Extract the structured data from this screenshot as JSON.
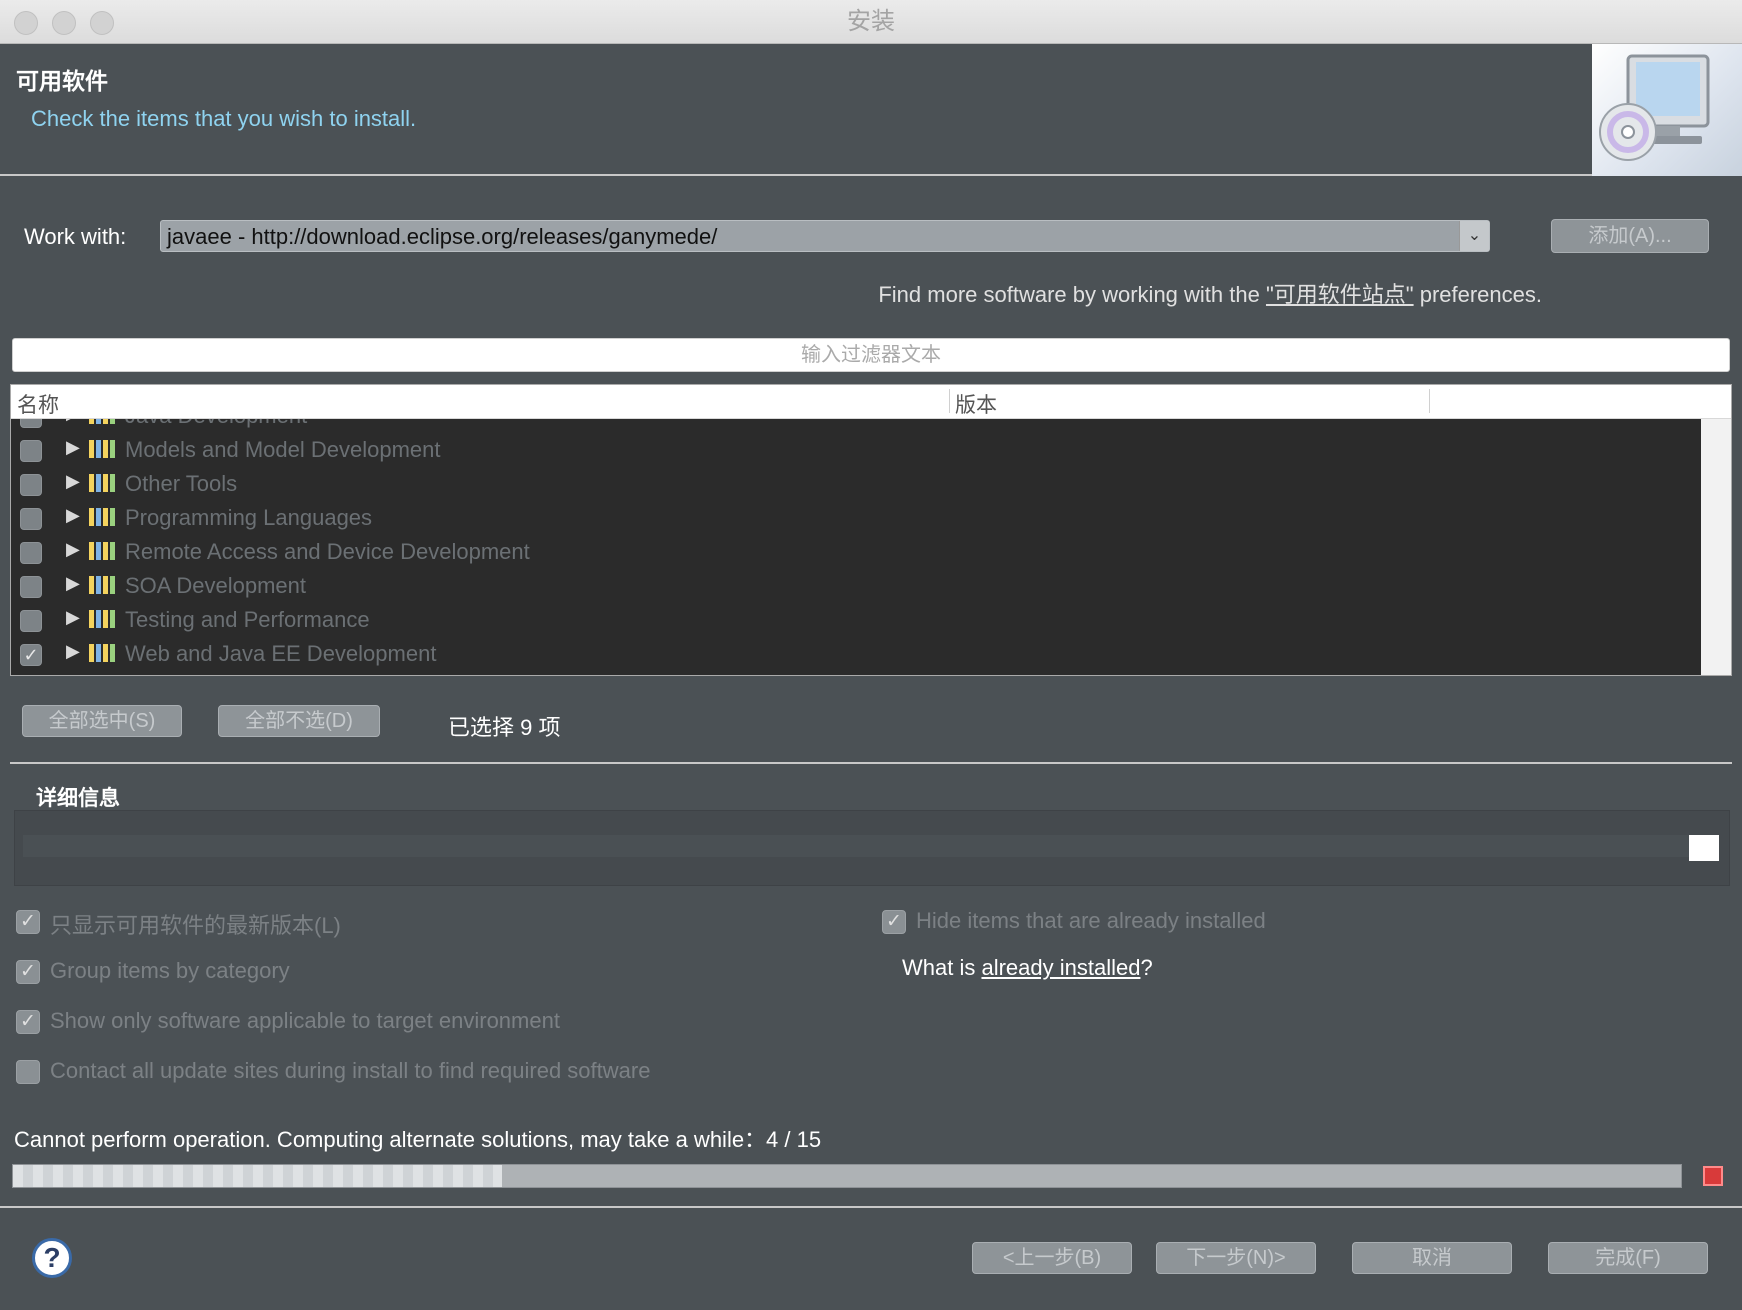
{
  "window": {
    "title": "安装"
  },
  "banner": {
    "title": "可用软件",
    "message": "Check the items that you wish to install."
  },
  "work_with": {
    "label": "Work with:",
    "value": "javaee - http://download.eclipse.org/releases/ganymede/",
    "add_button": "添加(A)..."
  },
  "find_more": {
    "prefix": "Find more software by working with the ",
    "link": "\"可用软件站点\"",
    "suffix": " preferences."
  },
  "filter": {
    "placeholder": "输入过滤器文本"
  },
  "tree": {
    "col_name": "名称",
    "col_version": "版本",
    "rows": [
      {
        "label": "Java Development",
        "checked": false
      },
      {
        "label": "Models and Model Development",
        "checked": false
      },
      {
        "label": "Other Tools",
        "checked": false
      },
      {
        "label": "Programming Languages",
        "checked": false
      },
      {
        "label": "Remote Access and Device Development",
        "checked": false
      },
      {
        "label": "SOA Development",
        "checked": false
      },
      {
        "label": "Testing and Performance",
        "checked": false
      },
      {
        "label": "Web and Java EE Development",
        "checked": true
      }
    ]
  },
  "selection": {
    "select_all": "全部选中(S)",
    "deselect_all": "全部不选(D)",
    "count_text": "已选择 9 项"
  },
  "details": {
    "title": "详细信息"
  },
  "options": {
    "latest_only": {
      "label": "只显示可用软件的最新版本(L)",
      "checked": true
    },
    "group_by_category": {
      "label": "Group items by category",
      "checked": true
    },
    "target_env": {
      "label": "Show only software applicable to target environment",
      "checked": true
    },
    "contact_sites": {
      "label": "Contact all update sites during install to find required software",
      "checked": false
    },
    "hide_installed": {
      "label": "Hide items that are already installed",
      "checked": true
    },
    "what_is_prefix": "What is ",
    "what_is_link": "already installed",
    "what_is_suffix": "?"
  },
  "status": {
    "message": "Cannot perform operation. Computing alternate solutions, may take a while：4 / 15",
    "progress_fraction": 0.2667
  },
  "footer": {
    "back": "<上一步(B)",
    "next": "下一步(N)>",
    "cancel": "取消",
    "finish": "完成(F)"
  },
  "icons": {
    "help": "?",
    "checkmark": "✓",
    "expand": "▶",
    "combo_arrow": "⌄"
  },
  "colors": {
    "dialog_bg": "#4b5155",
    "tree_bg": "#2b2b2b",
    "banner_message": "#8fd3f0",
    "stop_button": "#d83a3a"
  }
}
